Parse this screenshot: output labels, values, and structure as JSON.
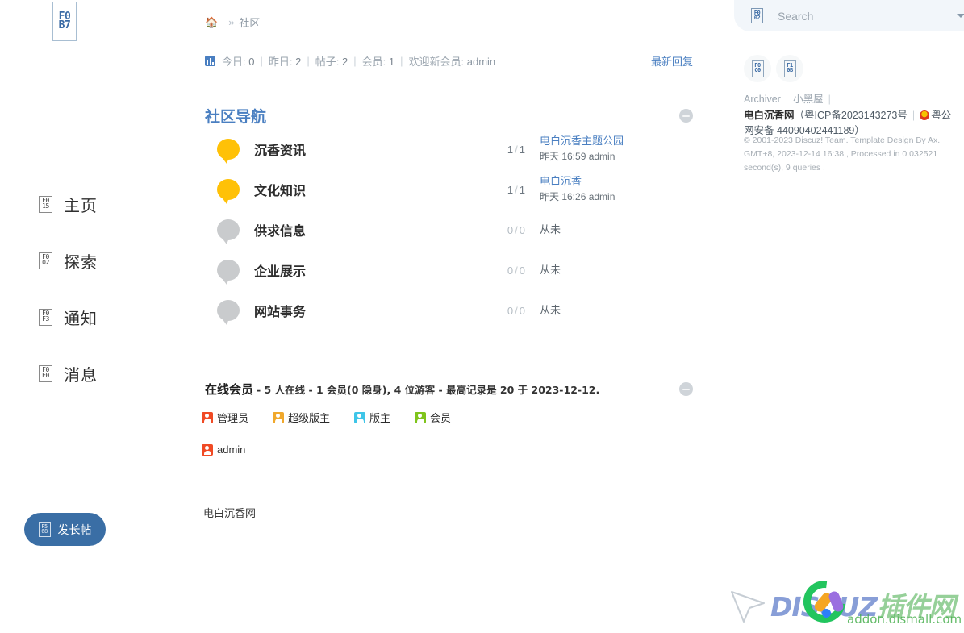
{
  "sidebar": {
    "logo_glyph": "F0\nB7",
    "items": [
      {
        "label": "主页",
        "icon": "home-icon",
        "glyph": "F0\n15"
      },
      {
        "label": "探索",
        "icon": "search-icon",
        "glyph": "F0\n02"
      },
      {
        "label": "通知",
        "icon": "bell-icon",
        "glyph": "F0\nF3"
      },
      {
        "label": "消息",
        "icon": "envelope-icon",
        "glyph": "F0\nE0"
      }
    ],
    "post_button": {
      "label": "发长帖",
      "glyph": "F5\n68"
    }
  },
  "breadcrumb": {
    "home_icon": "home-icon",
    "separator": "»",
    "current": "社区"
  },
  "stats": {
    "icon": "bar-chart-icon",
    "today_label": "今日:",
    "today_value": "0",
    "yesterday_label": "昨日:",
    "yesterday_value": "2",
    "posts_label": "帖子:",
    "posts_value": "2",
    "members_label": "会员:",
    "members_value": "1",
    "welcome_label": "欢迎新会员:",
    "welcome_value": "admin",
    "divider": "|",
    "latest_reply": "最新回复"
  },
  "forum_panel": {
    "title": "社区导航",
    "collapse_icon": "minus-circle-icon",
    "forums": [
      {
        "name": "沉香资讯",
        "icon_color": "#FFC107",
        "threads": "1",
        "posts": "1",
        "last_title": "电白沉香主题公园",
        "last_meta": "昨天 16:59 admin",
        "never": ""
      },
      {
        "name": "文化知识",
        "icon_color": "#FFC107",
        "threads": "1",
        "posts": "1",
        "last_title": "电白沉香",
        "last_meta": "昨天 16:26 admin",
        "never": ""
      },
      {
        "name": "供求信息",
        "icon_color": "#C9CBCD",
        "threads": "0",
        "posts": "0",
        "last_title": "",
        "last_meta": "",
        "never": "从未"
      },
      {
        "name": "企业展示",
        "icon_color": "#C9CBCD",
        "threads": "0",
        "posts": "0",
        "last_title": "",
        "last_meta": "",
        "never": "从未"
      },
      {
        "name": "网站事务",
        "icon_color": "#C9CBCD",
        "threads": "0",
        "posts": "0",
        "last_title": "",
        "last_meta": "",
        "never": "从未"
      }
    ]
  },
  "online_panel": {
    "title": "在线会员",
    "description": "- 5 人在线 - 1 会员(0 隐身), 4 位游客 - 最高记录是 20 于 2023-12-12.",
    "collapse_icon": "minus-circle-icon",
    "groups": [
      {
        "label": "管理员",
        "color": "#F04A24"
      },
      {
        "label": "超级版主",
        "color": "#F0A82C"
      },
      {
        "label": "版主",
        "color": "#3EC5E8"
      },
      {
        "label": "会员",
        "color": "#7FC41B"
      }
    ],
    "users": [
      {
        "name": "admin",
        "badge_color": "#F04A24"
      }
    ]
  },
  "main_footer": {
    "site_name": "电白沉香网"
  },
  "search": {
    "placeholder": "Search",
    "value": "",
    "icon": "search-icon",
    "glyph": "F0\n02",
    "caret_icon": "chevron-down-icon"
  },
  "quick_icons": [
    {
      "name": "qrcode-icon",
      "glyph": "F0\nC0"
    },
    {
      "name": "mobile-icon",
      "glyph": "F1\n0B"
    }
  ],
  "right_footer": {
    "links": [
      {
        "label": "Archiver"
      },
      {
        "label": "小黑屋"
      }
    ],
    "separator": "|",
    "site_name": "电白沉香网",
    "paren_open": "（",
    "icp": "粤ICP备2023143273号",
    "police_badge": "police-badge-icon",
    "police_text": "粤公网安备 44090402441189",
    "paren_close": "）",
    "copyright": "© 2001-2023 Discuz! Team. Template Design By Ax.",
    "processed": "GMT+8, 2023-12-14 16:38 , Processed in 0.032521 second(s), 9 queries ."
  },
  "watermark": {
    "text_left": "DISCUZ",
    "text_right": "插件网",
    "url": "addon.dismall.com",
    "cursor_icon": "cursor-arrow-icon"
  },
  "colors": {
    "accent_blue": "#4a7fc1",
    "button_blue": "#3a6ea5",
    "forum_active": "#FFC107",
    "forum_inactive": "#C9CBCD"
  }
}
